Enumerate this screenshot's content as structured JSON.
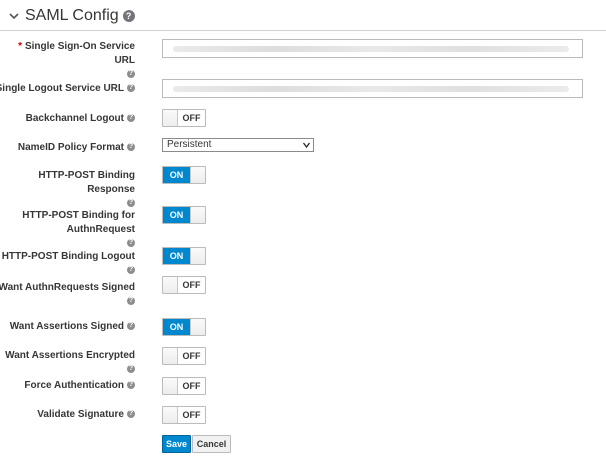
{
  "section": {
    "title": "SAML Config",
    "help_glyph": "?",
    "icons": {
      "collapse": "chevron-down-icon",
      "help": "question-circle-icon"
    }
  },
  "fields": {
    "sso_url": {
      "required_mark": "*",
      "label": "Single Sign-On Service URL",
      "value": ""
    },
    "slo_url": {
      "label": "Single Logout Service URL",
      "value": ""
    },
    "backchannel_logout": {
      "label": "Backchannel Logout",
      "state": "OFF"
    },
    "nameid_policy": {
      "label": "NameID Policy Format",
      "value": "Persistent"
    },
    "post_binding_response": {
      "label": "HTTP-POST Binding Response",
      "state": "ON"
    },
    "post_binding_authn": {
      "label_line1": "HTTP-POST Binding for",
      "label_line2": "AuthnRequest",
      "state": "ON"
    },
    "post_binding_logout": {
      "label": "HTTP-POST Binding Logout",
      "state": "ON"
    },
    "want_authn_signed": {
      "label": "Want AuthnRequests Signed",
      "state": "OFF"
    },
    "want_assertions_signed": {
      "label": "Want Assertions Signed",
      "state": "ON"
    },
    "want_assertions_encrypted": {
      "label": "Want Assertions Encrypted",
      "state": "OFF"
    },
    "force_authentication": {
      "label": "Force Authentication",
      "state": "OFF"
    },
    "validate_signature": {
      "label": "Validate Signature",
      "state": "OFF"
    }
  },
  "buttons": {
    "save": "Save",
    "cancel": "Cancel"
  },
  "colors": {
    "primary": "#0088ce",
    "required": "#cc0000",
    "text": "#363636"
  }
}
